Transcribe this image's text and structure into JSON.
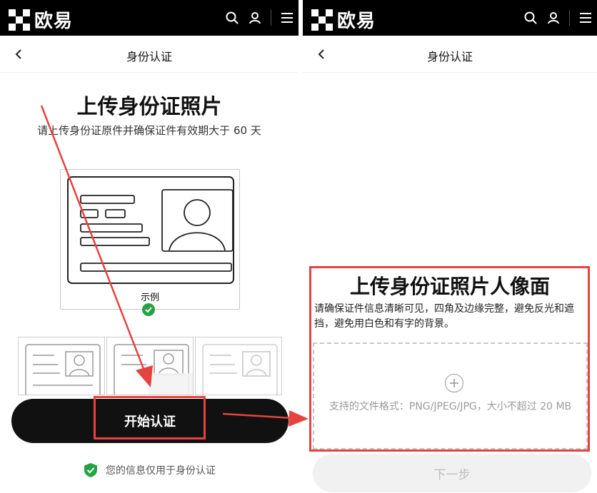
{
  "brand": {
    "name": "欧易"
  },
  "icons": {
    "search": "search-icon",
    "user": "user-icon",
    "menu": "menu-icon",
    "back": "back-arrow-icon",
    "shield": "shield-check-icon",
    "plus": "plus-circle-icon"
  },
  "colors": {
    "topbar": "#000000",
    "primary_button": "#111111",
    "highlight": "#e5433f",
    "success": "#25a244"
  },
  "left": {
    "nav_title": "身份认证",
    "heading": "上传身份证照片",
    "subtitle": "请上传身份证原件并确保证件有效期大于 60 天",
    "example_label": "示例",
    "start_button": "开始认证",
    "privacy_note": "您的信息仅用于身份认证"
  },
  "right": {
    "nav_title": "身份认证",
    "heading": "上传身份证照片人像面",
    "description": "请确保证件信息清晰可见，四角及边缘完整，避免反光和遮挡，避免用白色和有字的背景。",
    "dropzone_text": "支持的文件格式：PNG/JPEG/JPG，大小不超过 20 MB",
    "next_button": "下一步"
  }
}
